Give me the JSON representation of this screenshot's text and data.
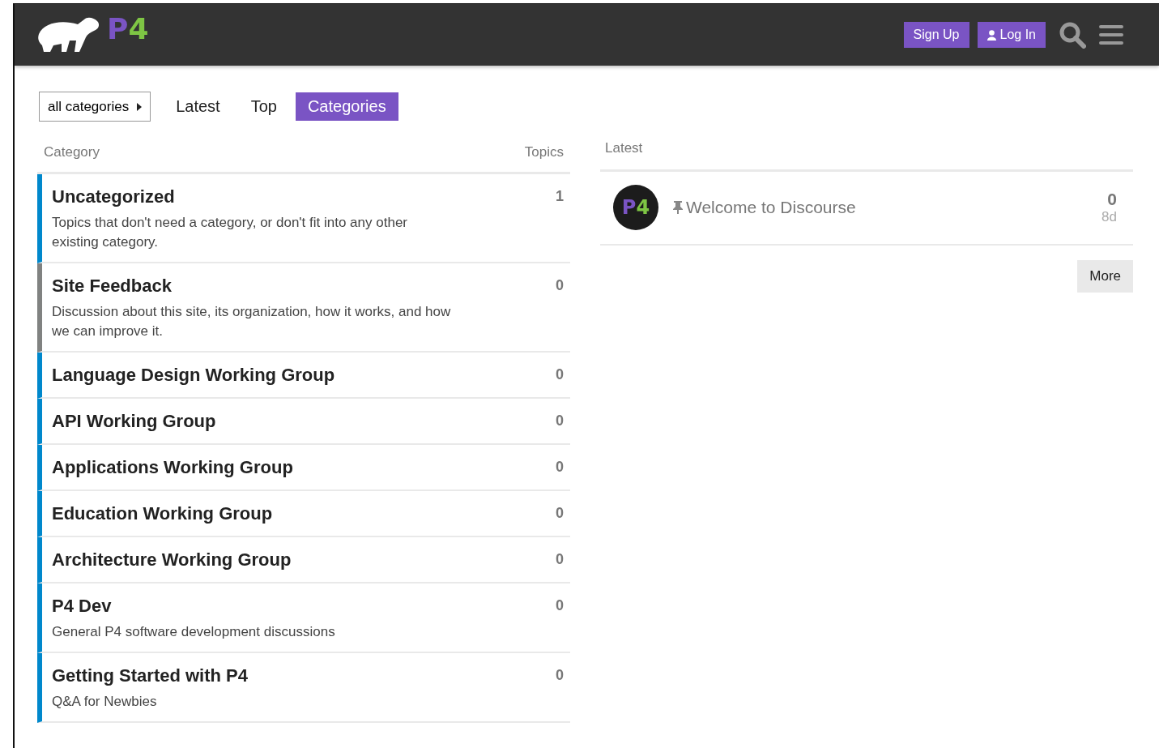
{
  "header": {
    "logo_letters": [
      {
        "char": "P",
        "color": "#7a54c4"
      },
      {
        "char": "4",
        "color": "#7ec544"
      }
    ],
    "buttons": [
      {
        "label": "Sign Up",
        "kind": "plain"
      },
      {
        "label": "Log In",
        "kind": "user"
      }
    ]
  },
  "nav": {
    "dropdown": "all categories",
    "tabs": [
      {
        "label": "Latest",
        "selected": false
      },
      {
        "label": "Top",
        "selected": false
      },
      {
        "label": "Categories",
        "selected": true
      }
    ]
  },
  "categories": {
    "columns": [
      "Category",
      "Topics"
    ],
    "rows": [
      {
        "name": "Uncategorized",
        "description": "Topics that don't need a category, or don't fit into any other existing category.",
        "topics": "1",
        "color": "#0088cc"
      },
      {
        "name": "Site Feedback",
        "description": "Discussion about this site, its organization, how it works, and how we can improve it.",
        "topics": "0",
        "color": "#808281"
      },
      {
        "name": "Language Design Working Group",
        "topics": "0",
        "color": "#0088cc"
      },
      {
        "name": "API Working Group",
        "topics": "0",
        "color": "#0088cc"
      },
      {
        "name": "Applications Working Group",
        "topics": "0",
        "color": "#0088cc"
      },
      {
        "name": "Education Working Group",
        "topics": "0",
        "color": "#0088cc"
      },
      {
        "name": "Architecture Working Group",
        "topics": "0",
        "color": "#0088cc"
      },
      {
        "name": "P4 Dev",
        "description": "General P4 software development discussions",
        "topics": "0",
        "color": "#0088cc"
      },
      {
        "name": "Getting Started with P4",
        "description": "Q&A for Newbies",
        "topics": "0",
        "color": "#0088cc"
      }
    ]
  },
  "latest": {
    "heading": "Latest",
    "topics": [
      {
        "title": "Welcome to Discourse",
        "pinned": true,
        "avatar_letters": [
          "P",
          "4"
        ],
        "replies": "0",
        "age": "8d"
      }
    ],
    "more": "More"
  }
}
